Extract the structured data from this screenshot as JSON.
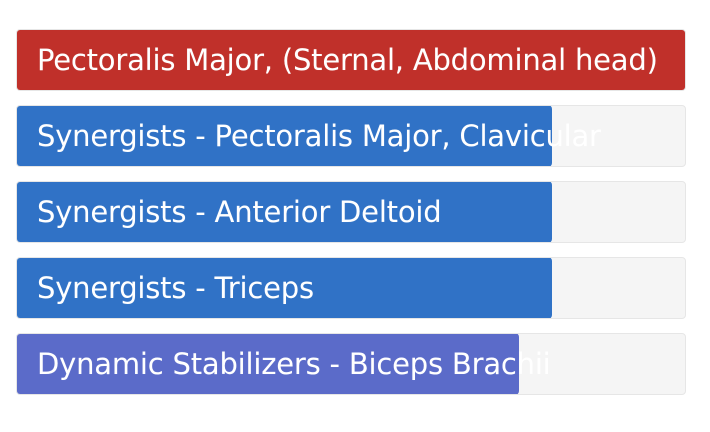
{
  "muscle_bars": [
    {
      "label": "Pectoralis Major, (Sternal, Abdominal head)",
      "level_percent": 100,
      "color": "#c0302a"
    },
    {
      "label": "Synergists - Pectoralis Major, Clavicular",
      "level_percent": 80,
      "color": "#3072c6"
    },
    {
      "label": "Synergists - Anterior Deltoid",
      "level_percent": 80,
      "color": "#3072c6"
    },
    {
      "label": "Synergists - Triceps",
      "level_percent": 80,
      "color": "#3072c6"
    },
    {
      "label": "Dynamic Stabilizers - Biceps Brachii",
      "level_percent": 75,
      "color": "#5b6bc9"
    }
  ]
}
